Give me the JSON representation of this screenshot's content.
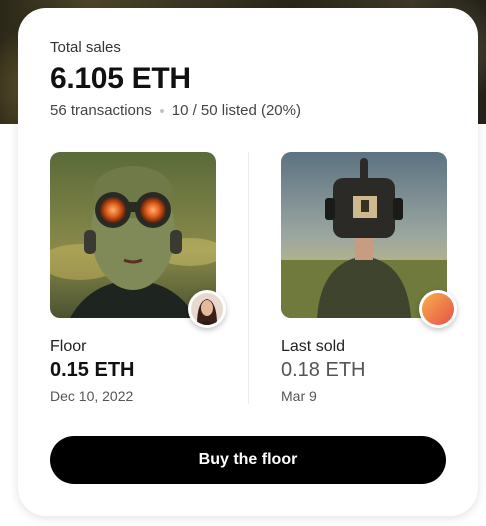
{
  "summary": {
    "total_sales_label": "Total sales",
    "total_sales_value": "6.105 ETH",
    "transactions": "56 transactions",
    "listed": "10 / 50 listed (20%)"
  },
  "floor": {
    "label": "Floor",
    "value": "0.15 ETH",
    "date": "Dec 10, 2022",
    "image_icon": "goggles-portrait-nft",
    "owner_icon": "avatar-woman"
  },
  "last_sold": {
    "label": "Last sold",
    "value": "0.18 ETH",
    "date": "Mar 9",
    "image_icon": "camera-head-portrait-nft",
    "owner_icon": "avatar-gradient",
    "owner_gradient": [
      "#f6b04a",
      "#e8504a"
    ]
  },
  "actions": {
    "buy_label": "Buy the floor"
  },
  "colors": {
    "button_bg": "#000000",
    "button_text": "#ffffff"
  }
}
